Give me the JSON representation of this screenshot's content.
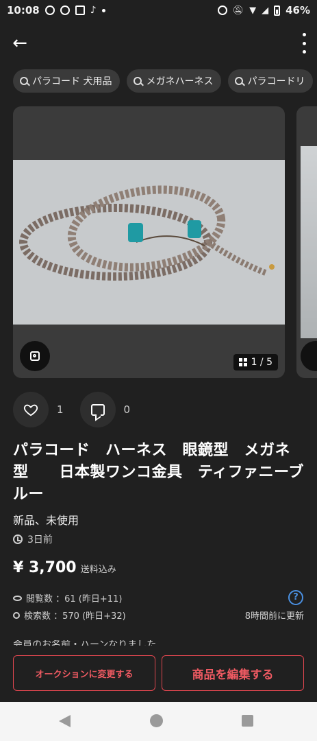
{
  "status_bar": {
    "time": "10:08",
    "battery": "46%"
  },
  "search_chips": [
    {
      "label": "パラコード 犬用品"
    },
    {
      "label": "メガネハーネス"
    },
    {
      "label": "パラコードリ"
    }
  ],
  "gallery": {
    "counter": "1 / 5"
  },
  "reactions": {
    "likes": "1",
    "comments": "0"
  },
  "item": {
    "title": "パラコード　ハーネス　眼鏡型　メガネ型　　日本製ワンコ金具　ティファニーブルー",
    "condition": "新品、未使用",
    "posted": "3日前",
    "price": "¥ 3,700",
    "shipping": "送料込み",
    "views": "閲覧数 ：61 (昨日+11)",
    "searches": "検索数 ：570 (昨日+32)",
    "updated": "8時間前に更新",
    "cutoff_text": "会員のお名前・ハーンなりました"
  },
  "actions": {
    "auction_label": "オークションに変更する",
    "edit_label": "商品を編集する"
  },
  "colors": {
    "accent": "#e0464f",
    "background": "#202020",
    "help": "#4a90e2"
  }
}
